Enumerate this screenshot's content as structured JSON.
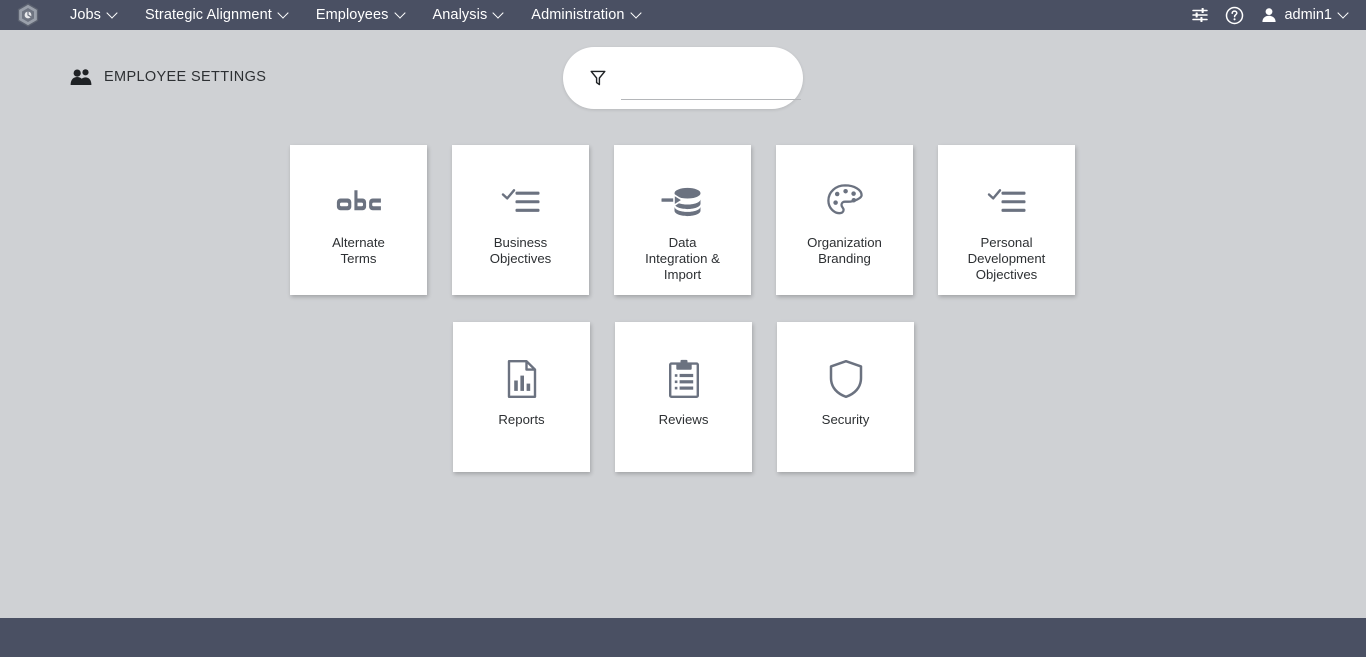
{
  "navbar": {
    "logo_icon": "hexagon-logo-icon",
    "background_color": "#4a5063",
    "menu_items": [
      {
        "label": "Jobs",
        "icon": "chevron-down-icon"
      },
      {
        "label": "Strategic Alignment",
        "icon": "chevron-down-icon"
      },
      {
        "label": "Employees",
        "icon": "chevron-down-icon"
      },
      {
        "label": "Analysis",
        "icon": "chevron-down-icon"
      },
      {
        "label": "Administration",
        "icon": "chevron-down-icon"
      }
    ],
    "actions": [
      {
        "name": "settings-sliders-icon"
      },
      {
        "name": "help-circle-icon"
      }
    ],
    "user": {
      "label": "admin1",
      "icon": "user-icon",
      "caret": "chevron-down-icon"
    }
  },
  "page": {
    "title": "EMPLOYEE SETTINGS",
    "title_icon": "people-group-icon",
    "background_color": "#cfd1d4",
    "text_color": "#2d3033"
  },
  "filter": {
    "icon": "filter-funnel-icon",
    "value": "",
    "placeholder": ""
  },
  "tiles": {
    "icon_color": "#6b7280",
    "rows": [
      [
        {
          "label": "Alternate\nTerms",
          "icon": "abc-text-icon"
        },
        {
          "label": "Business\nObjectives",
          "icon": "checklist-icon"
        },
        {
          "label": "Data\nIntegration &\nImport",
          "icon": "database-import-icon"
        },
        {
          "label": "Organization\nBranding",
          "icon": "palette-icon"
        },
        {
          "label": "Personal\nDevelopment\nObjectives",
          "icon": "checklist-icon"
        }
      ],
      [
        {
          "label": "Reports",
          "icon": "document-chart-icon"
        },
        {
          "label": "Reviews",
          "icon": "clipboard-list-icon"
        },
        {
          "label": "Security",
          "icon": "shield-icon"
        }
      ]
    ]
  },
  "footer": {
    "background_color": "#4a5063"
  }
}
